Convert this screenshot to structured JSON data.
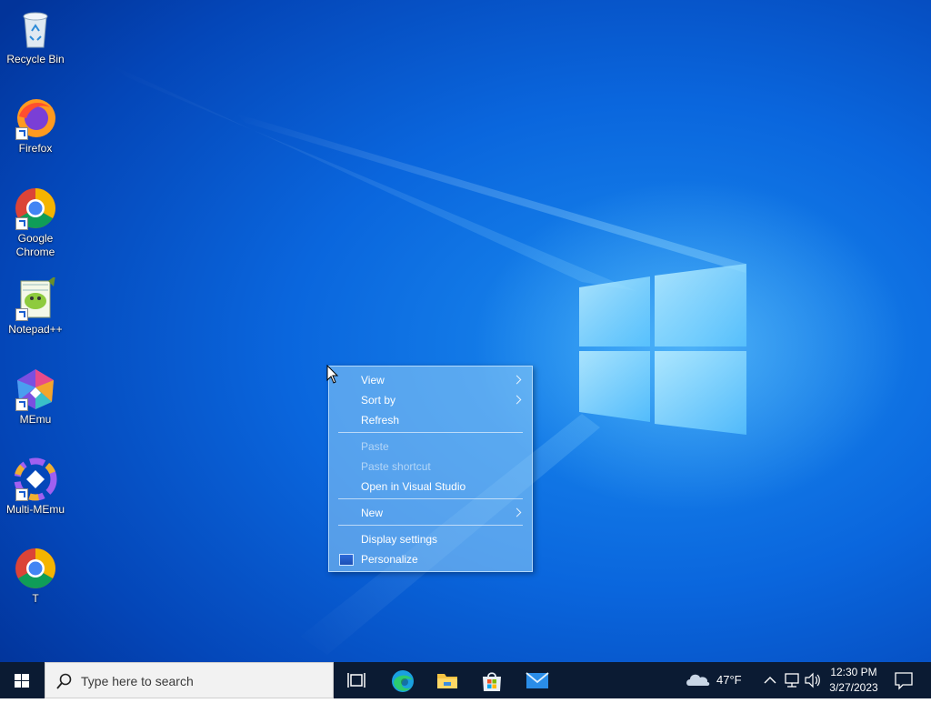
{
  "desktop": {
    "icons": [
      {
        "label": "Recycle Bin",
        "icon": "recycle-bin-icon"
      },
      {
        "label": "Firefox",
        "icon": "firefox-icon"
      },
      {
        "label": "Google Chrome",
        "icon": "chrome-icon"
      },
      {
        "label": "Notepad++",
        "icon": "notepad-plus-plus-icon"
      },
      {
        "label": "MEmu",
        "icon": "memu-icon"
      },
      {
        "label": "Multi-MEmu",
        "icon": "multi-memu-icon"
      },
      {
        "label": "T",
        "icon": "chrome-icon"
      }
    ]
  },
  "context_menu": {
    "items": [
      {
        "label": "View",
        "submenu": true,
        "enabled": true
      },
      {
        "label": "Sort by",
        "submenu": true,
        "enabled": true
      },
      {
        "label": "Refresh",
        "submenu": false,
        "enabled": true
      },
      {
        "label": "Paste",
        "submenu": false,
        "enabled": false
      },
      {
        "label": "Paste shortcut",
        "submenu": false,
        "enabled": false
      },
      {
        "label": "Open in Visual Studio",
        "submenu": false,
        "enabled": true
      },
      {
        "label": "New",
        "submenu": true,
        "enabled": true
      },
      {
        "label": "Display settings",
        "submenu": false,
        "enabled": true
      },
      {
        "label": "Personalize",
        "submenu": false,
        "enabled": true,
        "icon": "personalize-icon"
      }
    ]
  },
  "taskbar": {
    "search_placeholder": "Type here to search",
    "pinned": [
      "task-view-icon",
      "edge-icon",
      "file-explorer-icon",
      "microsoft-store-icon",
      "mail-icon"
    ],
    "weather": {
      "temp": "47°F",
      "icon": "cloud-icon"
    },
    "clock": {
      "time": "12:30 PM",
      "date": "3/27/2023"
    }
  },
  "colors": {
    "taskbar_bg": "#0b1b33",
    "desktop_blue": "#0a66dd",
    "accent": "#1a8cf0"
  }
}
